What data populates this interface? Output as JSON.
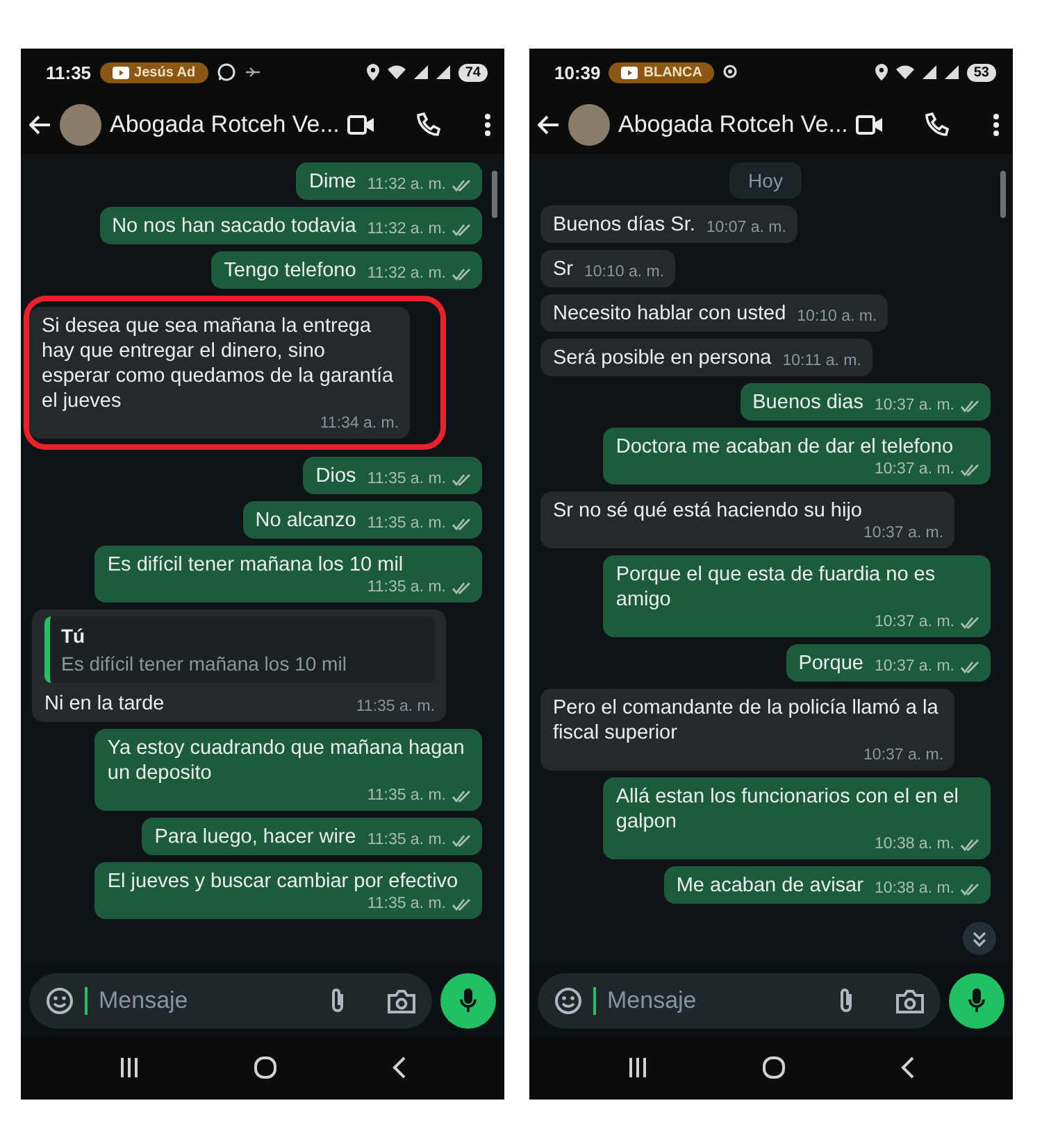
{
  "phones": [
    {
      "status_bar": {
        "time": "11:35",
        "notification_label": "Jesús Ad",
        "notifications": [
          {
            "kind": "chat"
          },
          {
            "kind": "cast"
          }
        ],
        "battery": "74"
      },
      "header": {
        "contact_name": "Abogada Rotceh Ve..."
      },
      "scroll_down_button": false,
      "messages": [
        {
          "kind": "out",
          "text": "Dime",
          "time": "11:32 a. m.",
          "highlighted": false
        },
        {
          "kind": "out",
          "text": "No nos han sacado todavia",
          "time": "11:32 a. m.",
          "highlighted": false
        },
        {
          "kind": "out",
          "text": "Tengo telefono",
          "time": "11:32 a. m.",
          "highlighted": false
        },
        {
          "kind": "in",
          "text": "Si desea que sea mañana la entrega hay que entregar el dinero, sino esperar como quedamos de la garantía el jueves",
          "time": "11:34 a. m.",
          "highlighted": true
        },
        {
          "kind": "out",
          "text": "Dios",
          "time": "11:35 a. m.",
          "highlighted": false
        },
        {
          "kind": "out",
          "text": "No alcanzo",
          "time": "11:35 a. m.",
          "highlighted": false
        },
        {
          "kind": "out",
          "text": "Es difícil tener mañana los 10 mil",
          "time": "11:35 a. m.",
          "highlighted": false
        },
        {
          "kind": "in",
          "quote": {
            "author": "Tú",
            "text": "Es difícil tener mañana los 10 mil"
          },
          "text": "Ni en la tarde",
          "time": "11:35 a. m.",
          "highlighted": false
        },
        {
          "kind": "out",
          "text": "Ya estoy cuadrando que mañana hagan un deposito",
          "time": "11:35 a. m.",
          "highlighted": false
        },
        {
          "kind": "out",
          "text": "Para luego, hacer wire",
          "time": "11:35 a. m.",
          "highlighted": false
        },
        {
          "kind": "out",
          "text": "El jueves y buscar cambiar por efectivo",
          "time": "11:35 a. m.",
          "highlighted": false
        }
      ],
      "composer": {
        "placeholder": "Mensaje"
      }
    },
    {
      "status_bar": {
        "time": "10:39",
        "notification_label": "BLANCA",
        "notifications": [
          {
            "kind": "location"
          }
        ],
        "battery": "53"
      },
      "header": {
        "contact_name": "Abogada Rotceh Ve..."
      },
      "scroll_down_button": true,
      "messages": [
        {
          "kind": "date",
          "text": "Hoy"
        },
        {
          "kind": "in",
          "text": "Buenos días Sr.",
          "time": "10:07 a. m.",
          "highlighted": false
        },
        {
          "kind": "in",
          "text": "Sr",
          "time": "10:10 a. m.",
          "highlighted": false
        },
        {
          "kind": "in",
          "text": "Necesito hablar con usted",
          "time": "10:10 a. m.",
          "highlighted": false
        },
        {
          "kind": "in",
          "text": "Será posible en persona",
          "time": "10:11 a. m.",
          "highlighted": false
        },
        {
          "kind": "out",
          "text": "Buenos dias",
          "time": "10:37 a. m.",
          "highlighted": false
        },
        {
          "kind": "out",
          "text": "Doctora me acaban de dar el telefono",
          "time": "10:37 a. m.",
          "highlighted": false
        },
        {
          "kind": "in",
          "text": "Sr no sé qué está haciendo su hijo",
          "time": "10:37 a. m.",
          "highlighted": false
        },
        {
          "kind": "out",
          "text": "Porque el que esta de fuardia no es amigo",
          "time": "10:37 a. m.",
          "highlighted": false
        },
        {
          "kind": "out",
          "text": "Porque",
          "time": "10:37 a. m.",
          "highlighted": false
        },
        {
          "kind": "in",
          "text": "Pero el comandante de la policía llamó a la fiscal superior",
          "time": "10:37 a. m.",
          "highlighted": false
        },
        {
          "kind": "out",
          "text": "Allá estan los funcionarios con el en el galpon",
          "time": "10:38 a. m.",
          "highlighted": false
        },
        {
          "kind": "out",
          "text": "Me acaban de avisar",
          "time": "10:38 a. m.",
          "highlighted": false
        }
      ],
      "composer": {
        "placeholder": "Mensaje"
      }
    }
  ]
}
